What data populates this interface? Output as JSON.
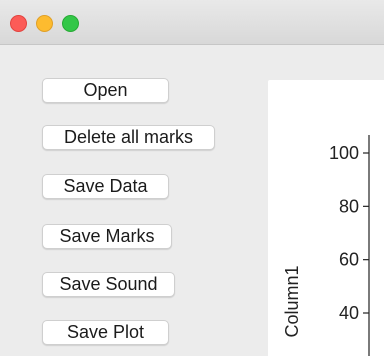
{
  "window": {
    "controls": [
      "close",
      "minimize",
      "zoom"
    ],
    "colors": {
      "close": "#fc5b57",
      "minimize": "#fdbb2f",
      "zoom": "#33c748"
    }
  },
  "buttons": {
    "open": "Open",
    "delete_all_marks": "Delete all marks",
    "save_data": "Save Data",
    "save_marks": "Save Marks",
    "save_sound": "Save Sound",
    "save_plot": "Save Plot"
  },
  "chart_data": {
    "type": "line",
    "ylabel": "Column1",
    "y_ticks": [
      100,
      80,
      60,
      40
    ],
    "ylim": [
      30,
      105
    ],
    "grid": false
  }
}
